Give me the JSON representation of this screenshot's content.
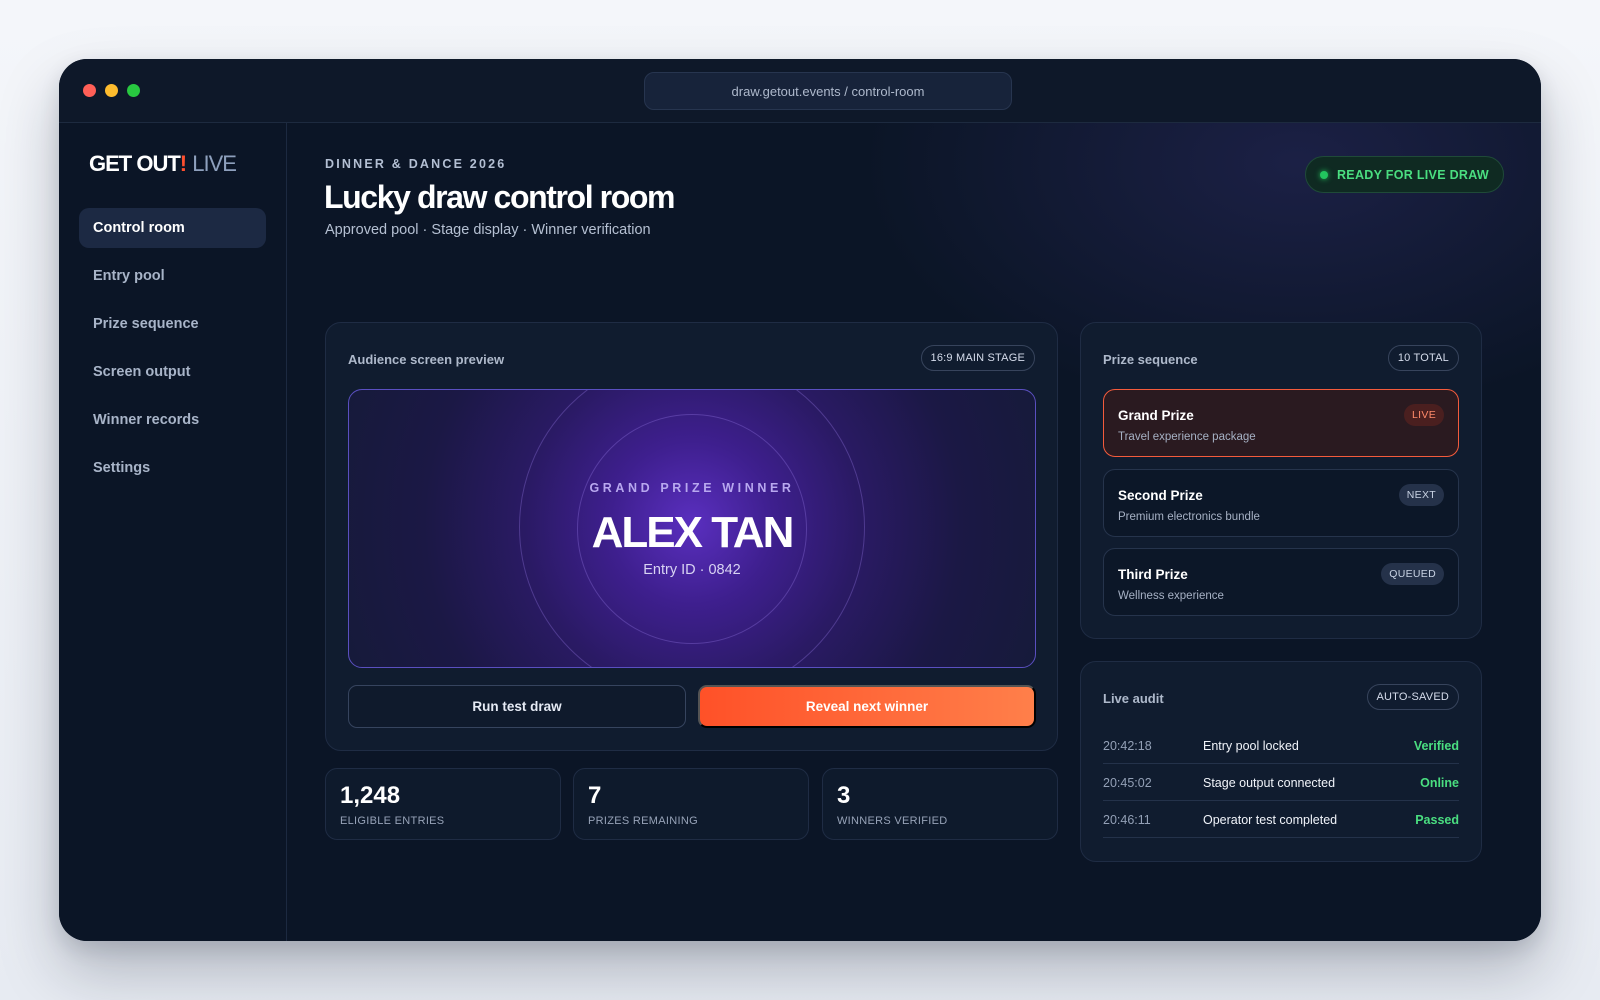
{
  "browser": {
    "url": "draw.getout.events / control-room"
  },
  "brand": {
    "name": "GET OUT",
    "bang": "!",
    "suffix": "LIVE"
  },
  "sidebar": {
    "items": [
      {
        "label": "Control room"
      },
      {
        "label": "Entry pool"
      },
      {
        "label": "Prize sequence"
      },
      {
        "label": "Screen output"
      },
      {
        "label": "Winner records"
      },
      {
        "label": "Settings"
      }
    ]
  },
  "header": {
    "eyebrow": "DINNER & DANCE 2026",
    "title": "Lucky draw control room",
    "subtitle": "Approved pool · Stage display · Winner verification",
    "status": "READY FOR LIVE DRAW"
  },
  "preview": {
    "title": "Audience screen preview",
    "badge": "16:9 MAIN STAGE",
    "label": "GRAND PRIZE WINNER",
    "winner": "ALEX TAN",
    "entry": "Entry ID · 0842",
    "test_button": "Run test draw",
    "reveal_button": "Reveal next winner"
  },
  "stats": [
    {
      "value": "1,248",
      "label": "ELIGIBLE ENTRIES"
    },
    {
      "value": "7",
      "label": "PRIZES REMAINING"
    },
    {
      "value": "3",
      "label": "WINNERS VERIFIED"
    }
  ],
  "prizes": {
    "title": "Prize sequence",
    "badge": "10 TOTAL",
    "items": [
      {
        "name": "Grand Prize",
        "desc": "Travel experience package",
        "status": "LIVE"
      },
      {
        "name": "Second Prize",
        "desc": "Premium electronics bundle",
        "status": "NEXT"
      },
      {
        "name": "Third Prize",
        "desc": "Wellness experience",
        "status": "QUEUED"
      }
    ]
  },
  "audit": {
    "title": "Live audit",
    "badge": "AUTO-SAVED",
    "rows": [
      {
        "time": "20:42:18",
        "event": "Entry pool locked",
        "status": "Verified"
      },
      {
        "time": "20:45:02",
        "event": "Stage output connected",
        "status": "Online"
      },
      {
        "time": "20:46:11",
        "event": "Operator test completed",
        "status": "Passed"
      }
    ]
  },
  "colors": {
    "accent": "#ff5128",
    "success": "#4ade80",
    "stage": "#5a2fbf"
  }
}
